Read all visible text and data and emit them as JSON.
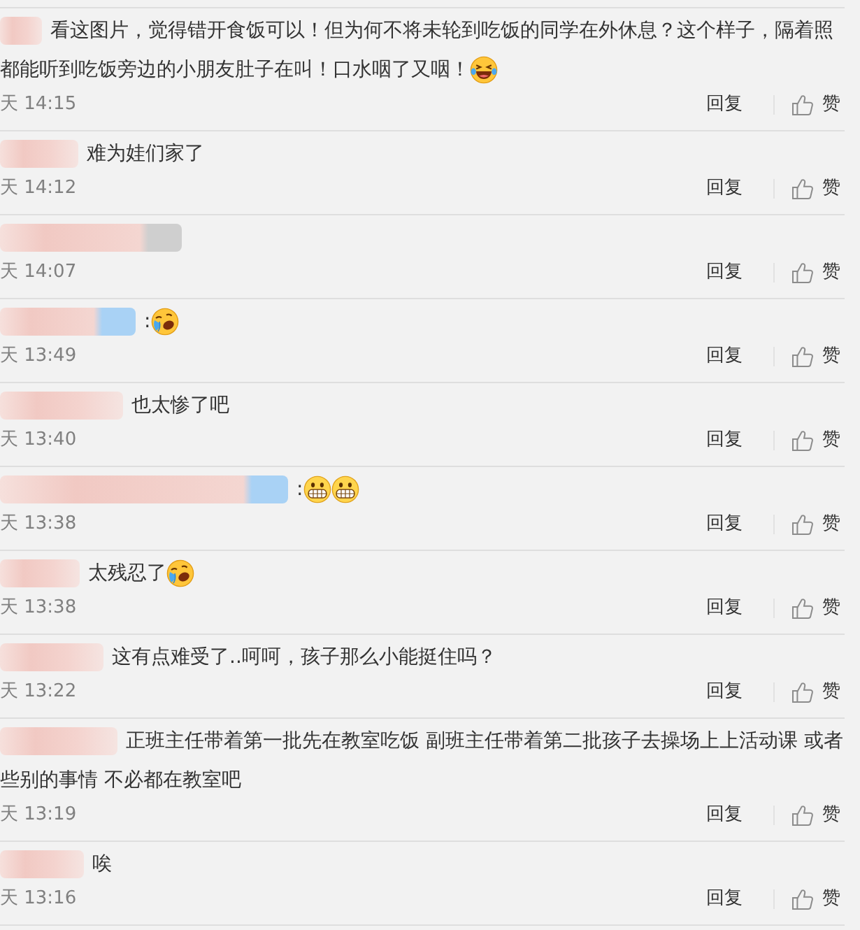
{
  "comments": [
    {
      "lines": [
        [
          {
            "kind": "text",
            "text": "看这图片，觉得错开食饭可以！但为何不将未轮到吃饭的同学在外休息？这个样子，隔着照"
          }
        ],
        [
          {
            "kind": "text",
            "text": "都能听到吃饭旁边的小朋友肚子在叫！口水咽了又咽！"
          },
          {
            "kind": "laughing"
          }
        ]
      ],
      "time": "天 14:15",
      "reply": "回复",
      "like": "赞"
    },
    {
      "lines": [
        [
          {
            "kind": "text",
            "text": "难为娃们家了"
          }
        ]
      ],
      "time": "天 14:12",
      "reply": "回复",
      "like": "赞"
    },
    {
      "time": "天 14:07",
      "reply": "回复",
      "like": "赞"
    },
    {
      "lines": [
        [
          {
            "kind": "text",
            "text": ":"
          },
          {
            "kind": "crying"
          }
        ]
      ],
      "time": "天 13:49",
      "reply": "回复",
      "like": "赞"
    },
    {
      "lines": [
        [
          {
            "kind": "text",
            "text": "也太惨了吧"
          }
        ]
      ],
      "time": "天 13:40",
      "reply": "回复",
      "like": "赞"
    },
    {
      "lines": [
        [
          {
            "kind": "text",
            "text": ":"
          },
          {
            "kind": "grinning"
          },
          {
            "kind": "grinning"
          }
        ]
      ],
      "time": "天 13:38",
      "reply": "回复",
      "like": "赞"
    },
    {
      "lines": [
        [
          {
            "kind": "text",
            "text": "太残忍了"
          },
          {
            "kind": "crying"
          }
        ]
      ],
      "time": "天 13:38",
      "reply": "回复",
      "like": "赞"
    },
    {
      "lines": [
        [
          {
            "kind": "text",
            "text": "这有点难受了..呵呵，孩子那么小能挺住吗？"
          }
        ]
      ],
      "time": "天 13:22",
      "reply": "回复",
      "like": "赞"
    },
    {
      "lines": [
        [
          {
            "kind": "text",
            "text": "正班主任带着第一批先在教室吃饭 副班主任带着第二批孩子去操场上上活动课 或者"
          }
        ],
        [
          {
            "kind": "text",
            "text": "些别的事情 不必都在教室吧"
          }
        ]
      ],
      "time": "天 13:19",
      "reply": "回复",
      "like": "赞"
    },
    {
      "lines": [
        [
          {
            "kind": "text",
            "text": "唉"
          }
        ]
      ],
      "time": "天 13:16",
      "reply": "回复",
      "like": "赞"
    }
  ]
}
